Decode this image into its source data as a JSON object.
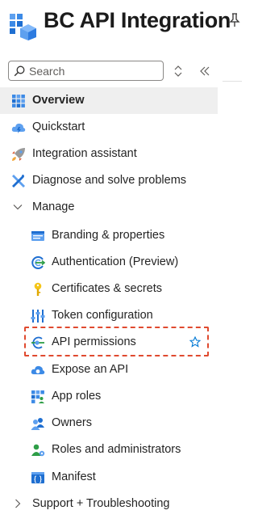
{
  "header": {
    "title": "BC API Integration"
  },
  "search": {
    "placeholder": "Search"
  },
  "nav": {
    "overview": "Overview",
    "quickstart": "Quickstart",
    "integration_assistant": "Integration assistant",
    "diagnose": "Diagnose and solve problems",
    "manage": "Manage",
    "branding": "Branding & properties",
    "authentication": "Authentication (Preview)",
    "certificates": "Certificates & secrets",
    "token_config": "Token configuration",
    "api_permissions": "API permissions",
    "expose_api": "Expose an API",
    "app_roles": "App roles",
    "owners": "Owners",
    "roles_admins": "Roles and administrators",
    "manifest": "Manifest",
    "support": "Support + Troubleshooting"
  },
  "colors": {
    "accent": "#0078d4",
    "highlight": "#e04a2f",
    "selected_bg": "#efefef"
  }
}
